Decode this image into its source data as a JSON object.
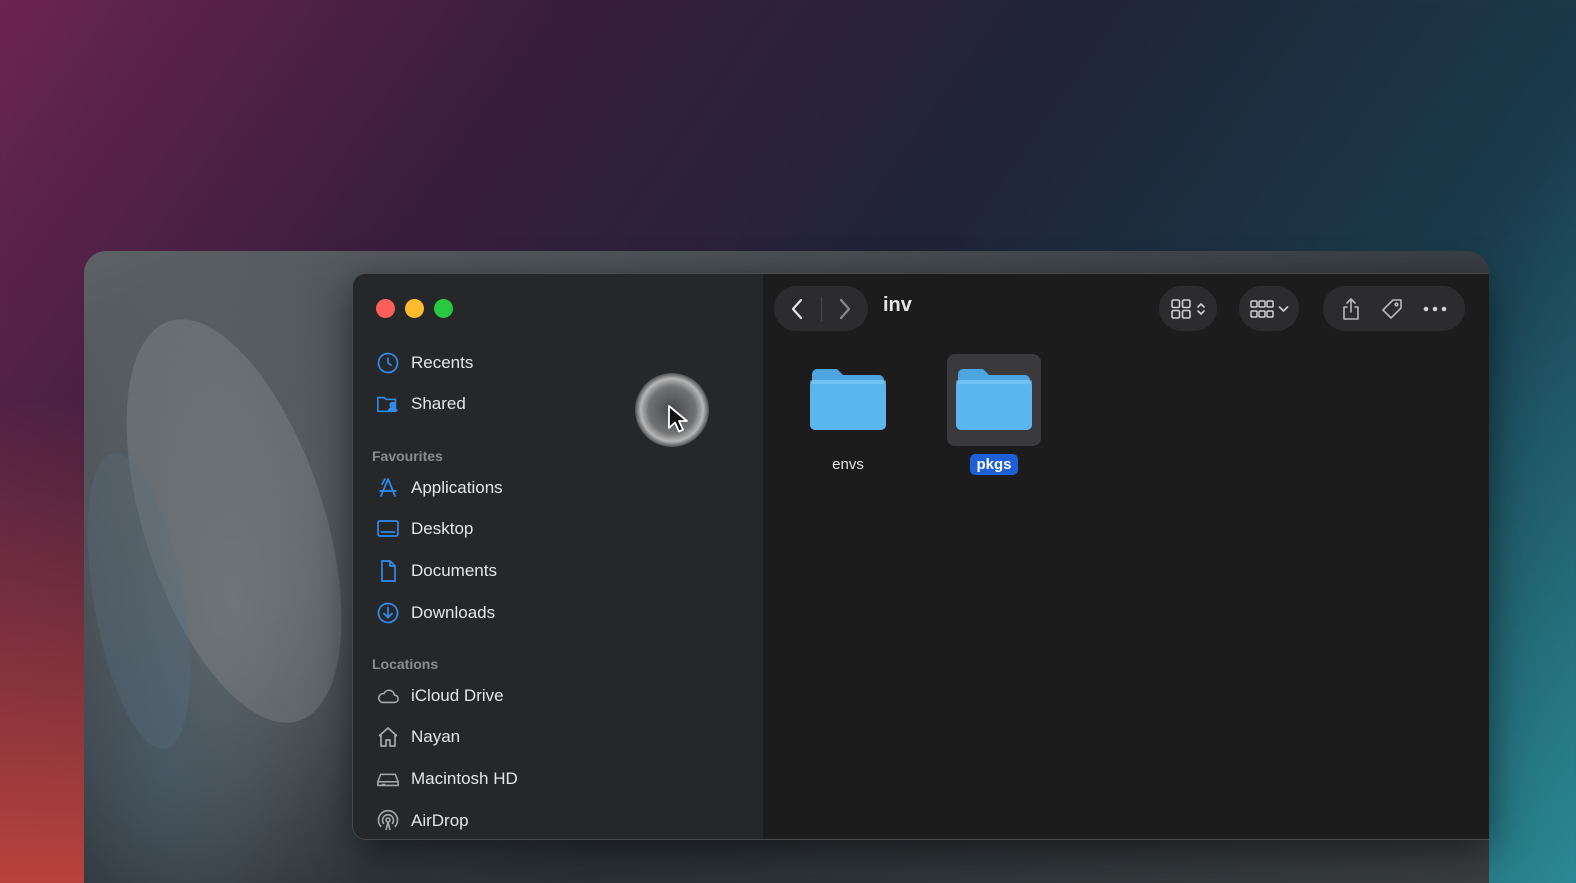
{
  "window": {
    "path_title": "inv"
  },
  "sidebar": {
    "top_items": [
      {
        "label": "Recents",
        "icon": "clock-icon"
      },
      {
        "label": "Shared",
        "icon": "shared-folder-icon"
      }
    ],
    "favourites": {
      "heading": "Favourites",
      "items": [
        {
          "label": "Applications",
          "icon": "applications-icon"
        },
        {
          "label": "Desktop",
          "icon": "desktop-icon"
        },
        {
          "label": "Documents",
          "icon": "document-icon"
        },
        {
          "label": "Downloads",
          "icon": "download-icon"
        }
      ]
    },
    "locations": {
      "heading": "Locations",
      "items": [
        {
          "label": "iCloud Drive",
          "icon": "cloud-icon"
        },
        {
          "label": "Nayan",
          "icon": "home-icon"
        },
        {
          "label": "Macintosh HD",
          "icon": "hard-drive-icon"
        },
        {
          "label": "AirDrop",
          "icon": "airdrop-icon"
        }
      ]
    }
  },
  "files": [
    {
      "name": "envs",
      "selected": false
    },
    {
      "name": "pkgs",
      "selected": true
    }
  ],
  "colors": {
    "accent": "#2f8cf0",
    "selection": "#1f5fd6",
    "folder": "#5cb6ee"
  }
}
